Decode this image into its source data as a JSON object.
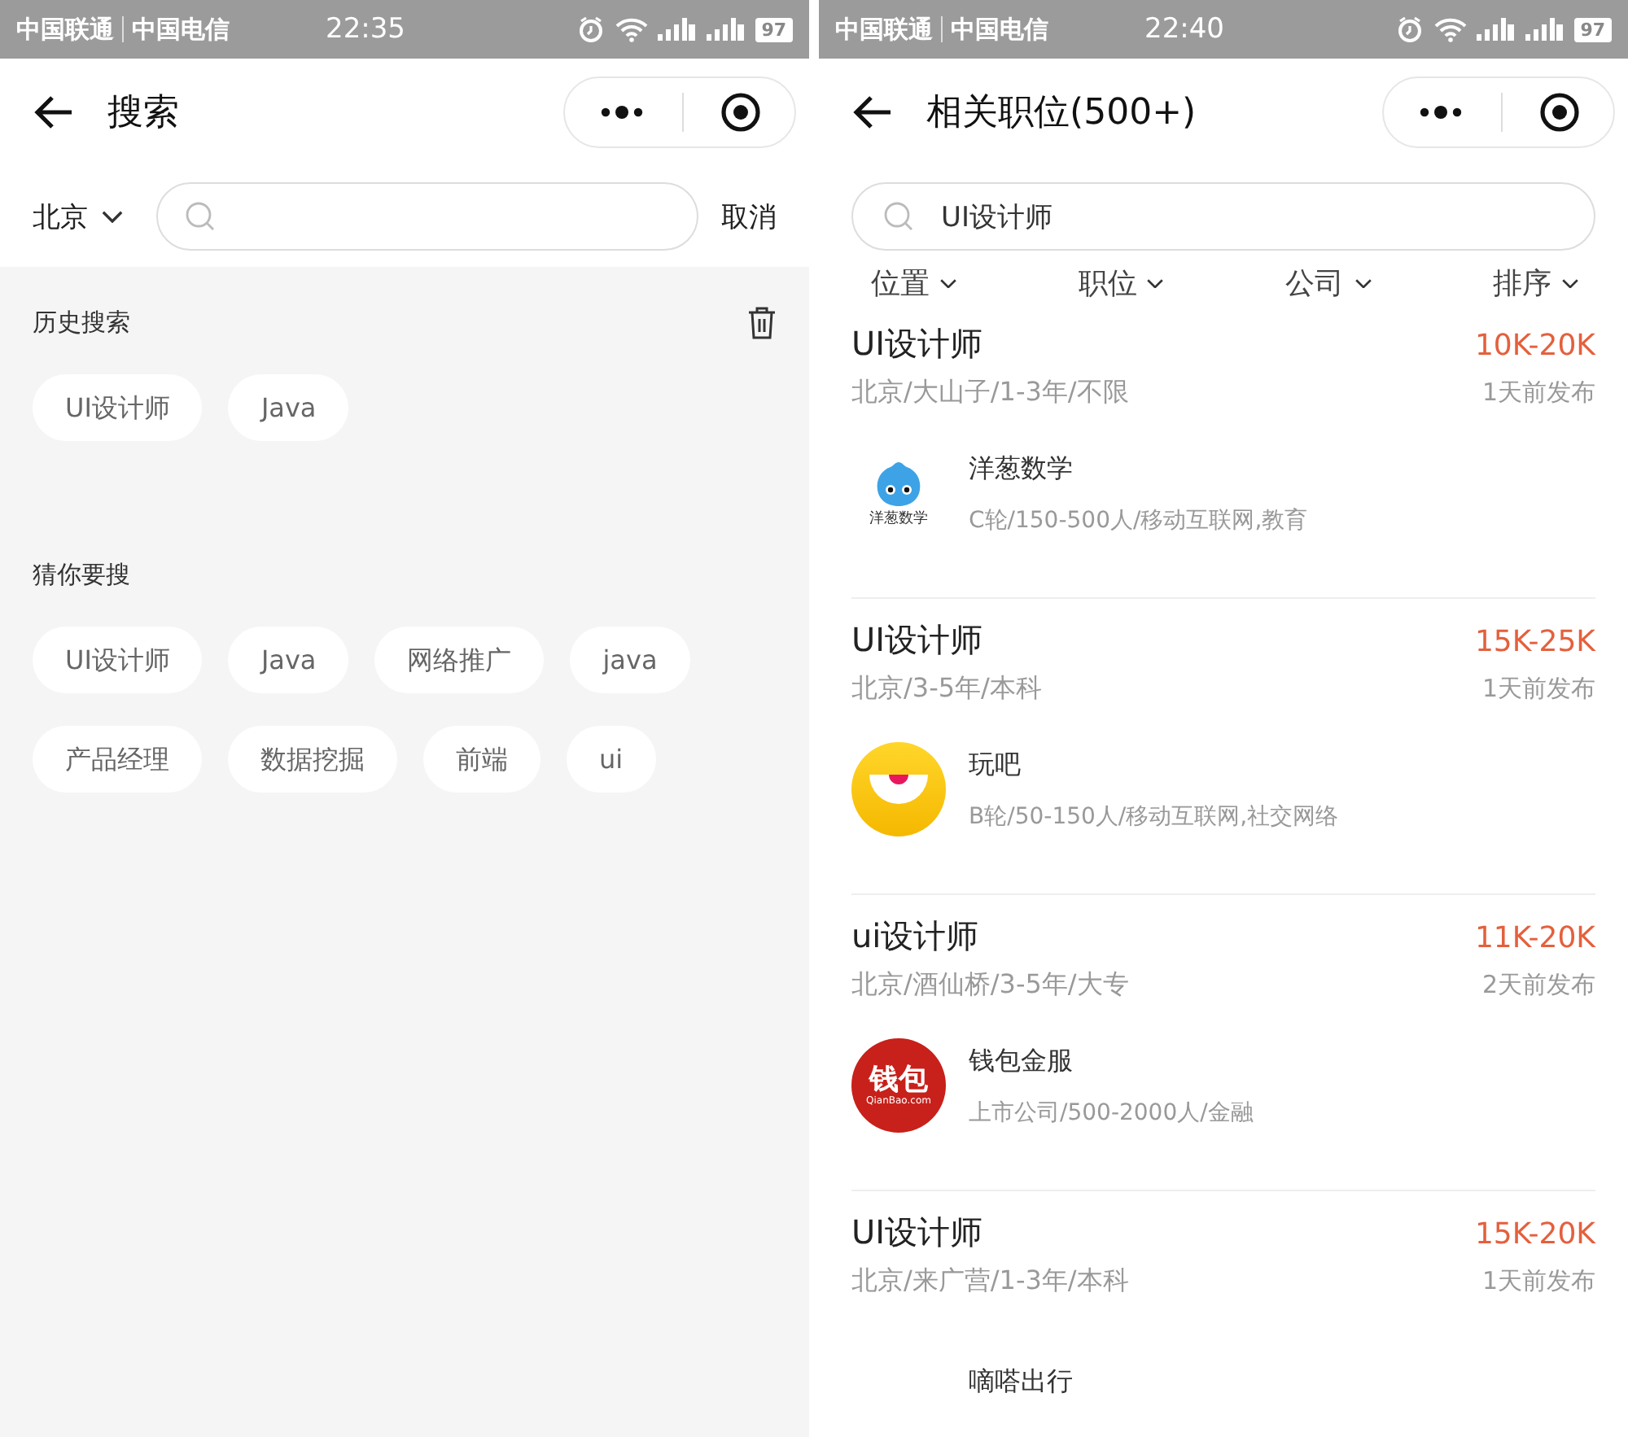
{
  "left": {
    "status_bar": {
      "carriers": [
        "中国联通",
        "中国电信"
      ],
      "time": "22:35",
      "battery": "97"
    },
    "nav": {
      "title": "搜索"
    },
    "search": {
      "city": "北京",
      "cancel": "取消"
    },
    "sections": [
      {
        "title": "历史搜索",
        "clearable": true,
        "tags": [
          "UI设计师",
          "Java"
        ]
      },
      {
        "title": "猜你要搜",
        "clearable": false,
        "tags": [
          "UI设计师",
          "Java",
          "网络推广",
          "java",
          "产品经理",
          "数据挖掘",
          "前端",
          "ui"
        ]
      }
    ]
  },
  "right": {
    "status_bar": {
      "carriers": [
        "中国联通",
        "中国电信"
      ],
      "time": "22:40",
      "battery": "97"
    },
    "nav": {
      "title": "相关职位(500+)"
    },
    "search": {
      "value": "UI设计师"
    },
    "filters": [
      "位置",
      "职位",
      "公司",
      "排序"
    ],
    "jobs": [
      {
        "title": "UI设计师",
        "salary": "10K-20K",
        "meta": "北京/大山子/1-3年/不限",
        "posted": "1天前发布",
        "company": "洋葱数学",
        "company_info": "C轮/150-500人/移动互联网,教育",
        "logo": {
          "kind": "mascot",
          "caption": "洋葱数学"
        }
      },
      {
        "title": "UI设计师",
        "salary": "15K-25K",
        "meta": "北京/3-5年/本科",
        "posted": "1天前发布",
        "company": "玩吧",
        "company_info": "B轮/50-150人/移动互联网,社交网络",
        "logo": {
          "kind": "smile"
        }
      },
      {
        "title": "ui设计师",
        "salary": "11K-20K",
        "meta": "北京/酒仙桥/3-5年/大专",
        "posted": "2天前发布",
        "company": "钱包金服",
        "company_info": "上市公司/500-2000人/金融",
        "logo": {
          "kind": "wordmark",
          "caption": "钱包",
          "subcaption": "QianBao.com"
        }
      },
      {
        "title": "UI设计师",
        "salary": "15K-20K",
        "meta": "北京/来广营/1-3年/本科",
        "posted": "1天前发布",
        "company": "嘀嗒出行",
        "logo": {
          "kind": "hidden"
        }
      }
    ]
  }
}
